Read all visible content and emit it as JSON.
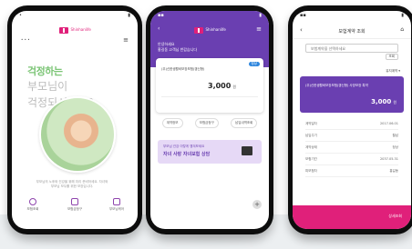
{
  "colors": {
    "brand_pink": "#e0207a",
    "brand_purple": "#6a3fb1",
    "accent_green": "#7cc576",
    "lavender": "#e6d9f6"
  },
  "phone1": {
    "status_time": "•",
    "logo_text": "Shinhanlife",
    "page_dots": "• • •",
    "menu_icon": "menu-icon",
    "hero_line1": "걱정하는",
    "hero_line2": "부모님이",
    "hero_line3": "걱정되시나요?",
    "description": "부모님의 노후와 건강을 위해 미리 준비하세요. 자녀와 부모님 모두를 위한 보장입니다.",
    "nav": [
      {
        "icon": "search-icon",
        "label": "보험조회"
      },
      {
        "icon": "home-icon",
        "label": "보험금청구"
      },
      {
        "icon": "document-icon",
        "label": "부모님케어"
      }
    ]
  },
  "phone2": {
    "logo_text": "Shinhanlife",
    "user_line1": "안녕하세요",
    "user_line2": "홍길동 고객님 반갑습니다",
    "card_badge": "정상",
    "card_title": "(무)신한생활비보장보험(갱신형)",
    "amount": "3,000",
    "unit": "원",
    "buttons": [
      "계약정보",
      "보험금청구",
      "납입내역조회"
    ],
    "promo_line1": "부모님 건강 이렇게 챙겨보세요",
    "promo_line2": "자녀 사랑 자녀보험 상담",
    "fab": "+"
  },
  "phone3": {
    "title": "보험계약 조회",
    "back_icon": "‹",
    "home_icon": "⌂",
    "select_placeholder": "보험계약을 선택하세요",
    "search_label": "조회",
    "filter_label": "유지계약 ▾",
    "card_title": "(무)신한생활비보장보험(갱신형) 사망보장 특약",
    "amount": "3,000",
    "unit": "원",
    "rows": [
      {
        "label": "계약일자",
        "value": "2017.06.01"
      },
      {
        "label": "납입주기",
        "value": "월납"
      },
      {
        "label": "계약상태",
        "value": "정상"
      },
      {
        "label": "보험기간",
        "value": "2037.05.31"
      },
      {
        "label": "피보험자",
        "value": "홍길동"
      }
    ],
    "bottom_button": "상세조회"
  }
}
